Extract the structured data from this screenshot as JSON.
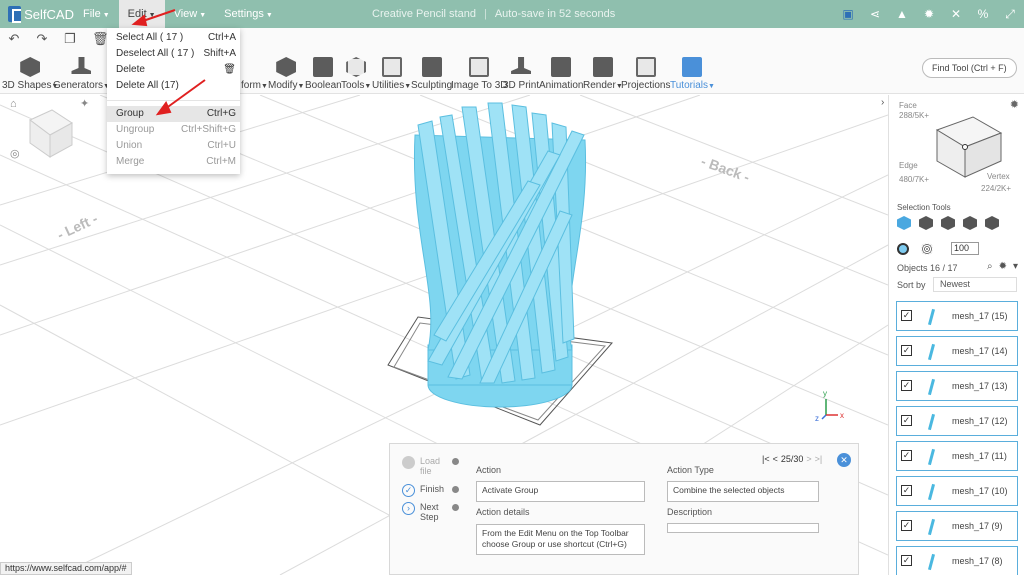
{
  "app": {
    "name": "SelfCAD"
  },
  "menu": [
    {
      "label": "File"
    },
    {
      "label": "Edit",
      "active": true
    },
    {
      "label": "View"
    },
    {
      "label": "Settings"
    }
  ],
  "title": {
    "project": "Creative Pencil stand",
    "autosave": "Auto-save in 52 seconds"
  },
  "top_icons": [
    "save-icon",
    "share-icon",
    "bell-icon",
    "gear-icon",
    "close-icon",
    "percent-icon",
    "expand-icon"
  ],
  "quickbar": [
    "undo-icon",
    "redo-icon",
    "copy-icon",
    "trash-icon"
  ],
  "toolbar": [
    {
      "label": "3D Shapes",
      "caret": true
    },
    {
      "label": "Generators",
      "caret": true
    },
    {
      "label": "form",
      "caret": true
    },
    {
      "label": "Modify",
      "caret": true
    },
    {
      "label": "Boolean"
    },
    {
      "label": "Tools",
      "caret": true
    },
    {
      "label": "Utilities",
      "caret": true
    },
    {
      "label": "Sculpting"
    },
    {
      "label": "Image To 3D"
    },
    {
      "label": "3D Print"
    },
    {
      "label": "Animation"
    },
    {
      "label": "Render",
      "caret": true
    },
    {
      "label": "Projections"
    },
    {
      "label": "Tutorials",
      "caret": true,
      "accent": "#4a90d9"
    }
  ],
  "find_tool": {
    "placeholder": "Find Tool (Ctrl + F)"
  },
  "edit_menu": {
    "items": [
      {
        "label": "Select All  ( 17 )",
        "shortcut": "Ctrl+A"
      },
      {
        "label": "Deselect All  ( 17 )",
        "shortcut": "Shift+A"
      },
      {
        "label": "Delete",
        "shortcut": ""
      },
      {
        "label": "Delete All (17)",
        "shortcut": ""
      },
      {
        "label": "Group",
        "shortcut": "Ctrl+G",
        "highlighted": true
      },
      {
        "label": "Ungroup",
        "shortcut": "Ctrl+Shift+G",
        "disabled": true
      },
      {
        "label": "Union",
        "shortcut": "Ctrl+U",
        "disabled": true
      },
      {
        "label": "Merge",
        "shortcut": "Ctrl+M",
        "disabled": true
      }
    ]
  },
  "viewport": {
    "labels": {
      "back": "- Back -",
      "left": "- Left -"
    },
    "axis": {
      "x": "x",
      "y": "y",
      "z": "z"
    },
    "model_color": "#7ed6f0"
  },
  "right_panel": {
    "face_label": "Face",
    "face_count": "288/5K+",
    "edge_label": "Edge",
    "edge_count": "480/7K+",
    "vertex_label": "Vertex",
    "vertex_count": "224/2K+",
    "selection_tools_label": "Selection Tools",
    "brush_size": "100",
    "objects_label": "Objects 16 / 17",
    "sort_label": "Sort by",
    "sort_value": "Newest",
    "objects": [
      {
        "name": "mesh_17 (15)",
        "checked": true
      },
      {
        "name": "mesh_17 (14)",
        "checked": true
      },
      {
        "name": "mesh_17 (13)",
        "checked": true
      },
      {
        "name": "mesh_17 (12)",
        "checked": true
      },
      {
        "name": "mesh_17 (11)",
        "checked": true
      },
      {
        "name": "mesh_17 (10)",
        "checked": true
      },
      {
        "name": "mesh_17 (9)",
        "checked": true
      },
      {
        "name": "mesh_17 (8)",
        "checked": true
      }
    ]
  },
  "tutorial": {
    "steps": [
      {
        "label": "Load file",
        "state": "pending"
      },
      {
        "label": "Finish",
        "state": "done"
      },
      {
        "label": "Next Step",
        "state": "next"
      }
    ],
    "action_label": "Action",
    "action_value": "Activate Group",
    "action_details_label": "Action details",
    "action_details_value": "From the Edit Menu on the Top Toolbar choose Group or use shortcut  (Ctrl+G)",
    "action_type_label": "Action Type",
    "action_type_value": "Combine the selected objects",
    "description_label": "Description",
    "description_value": "",
    "pager": "25/30"
  },
  "status_url": "https://www.selfcad.com/app/#"
}
